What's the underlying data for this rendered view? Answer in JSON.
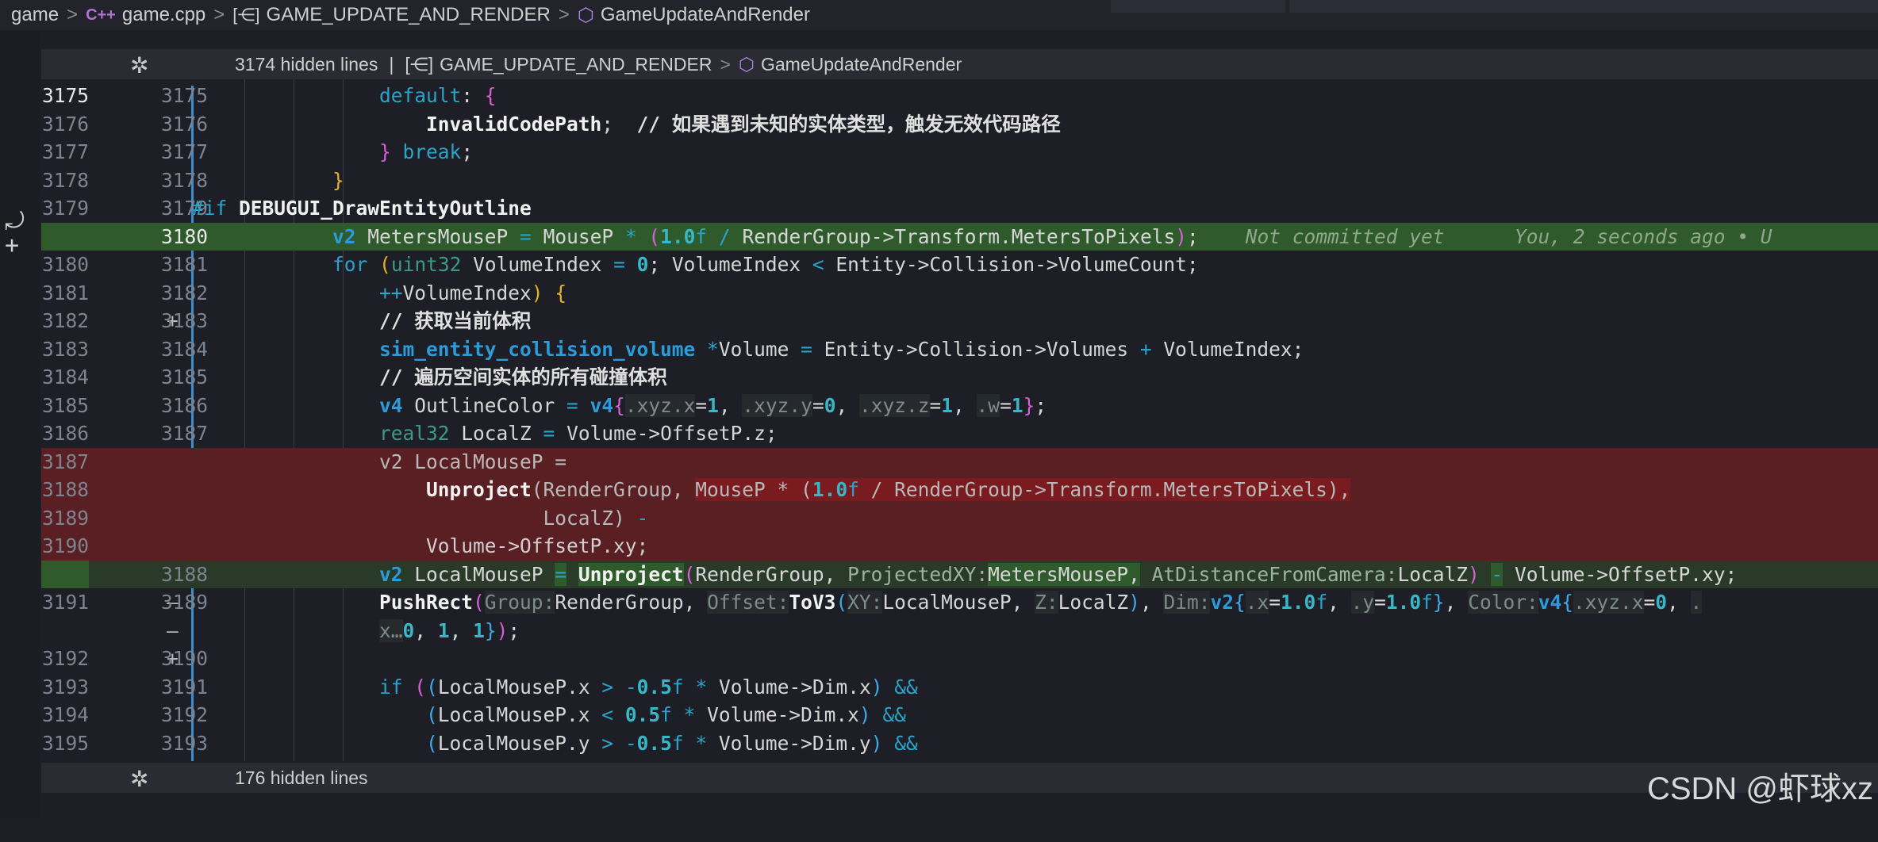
{
  "breadcrumb": {
    "folder": "game",
    "file_icon": "C++",
    "file": "game.cpp",
    "namespace": "GAME_UPDATE_AND_RENDER",
    "function": "GameUpdateAndRender",
    "separator": ">"
  },
  "fold_top": {
    "hidden": "3174 hidden lines",
    "pipe": "|",
    "namespace": "GAME_UPDATE_AND_RENDER",
    "function": "GameUpdateAndRender"
  },
  "fold_bottom": {
    "hidden": "176 hidden lines"
  },
  "blame": {
    "status": "Not committed yet",
    "author": "You, 2 seconds ago • U"
  },
  "line_numbers": {
    "l1": [
      "3175",
      "3175"
    ],
    "l2": [
      "3176",
      "3176"
    ],
    "l3": [
      "3177",
      "3177"
    ],
    "l4": [
      "3178",
      "3178"
    ],
    "l5": [
      "3179",
      "3179"
    ],
    "l6": [
      "",
      "3180"
    ],
    "l7": [
      "3180",
      "3181"
    ],
    "l8": [
      "3181",
      "3182"
    ],
    "l9": [
      "3182",
      "3183"
    ],
    "l10": [
      "3183",
      "3184"
    ],
    "l11": [
      "3184",
      "3185"
    ],
    "l12": [
      "3185",
      "3186"
    ],
    "l13": [
      "3186",
      "3187"
    ],
    "l14": [
      "3187",
      ""
    ],
    "l15": [
      "3188",
      ""
    ],
    "l16": [
      "3189",
      ""
    ],
    "l17": [
      "3190",
      ""
    ],
    "l18": [
      "",
      "3188"
    ],
    "l19": [
      "3191",
      "3189"
    ],
    "l21": [
      "3192",
      "3190"
    ],
    "l22": [
      "3193",
      "3191"
    ],
    "l23": [
      "3194",
      "3192"
    ],
    "l24": [
      "3195",
      "3193"
    ]
  },
  "markers": {
    "plus": "+",
    "minus": "—"
  },
  "comments": {
    "c1": "// 如果遇到未知的实体类型，触发无效代码路径",
    "c2": "// 获取当前体积",
    "c3": "// 遍历空间实体的所有碰撞体积"
  },
  "watermark": "CSDN @虾球xz"
}
